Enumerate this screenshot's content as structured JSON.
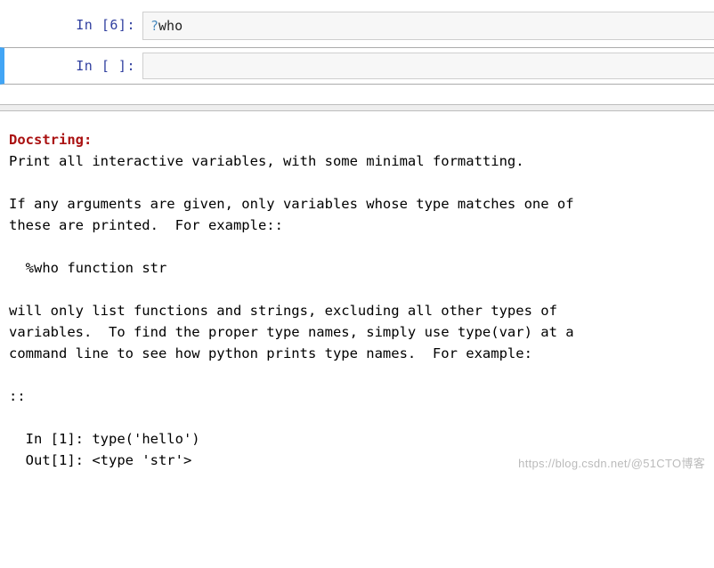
{
  "cells": [
    {
      "prompt": "In [6]:",
      "qmark": "?",
      "code": "who",
      "selected": false
    },
    {
      "prompt": "In [ ]:",
      "qmark": "",
      "code": "",
      "selected": true
    }
  ],
  "docstring": {
    "label": "Docstring:",
    "line1": "Print all interactive variables, with some minimal formatting.",
    "para1a": "If any arguments are given, only variables whose type matches one of",
    "para1b": "these are printed.  For example::",
    "example1": "  %who function str",
    "para2a": "will only list functions and strings, excluding all other types of",
    "para2b": "variables.  To find the proper type names, simply use type(var) at a",
    "para2c": "command line to see how python prints type names.  For example:",
    "cc": "::",
    "ex_in": "  In [1]: type('hello')",
    "ex_out": "  Out[1]: <type 'str'>"
  },
  "watermark": "https://blog.csdn.net/@51CTO博客"
}
